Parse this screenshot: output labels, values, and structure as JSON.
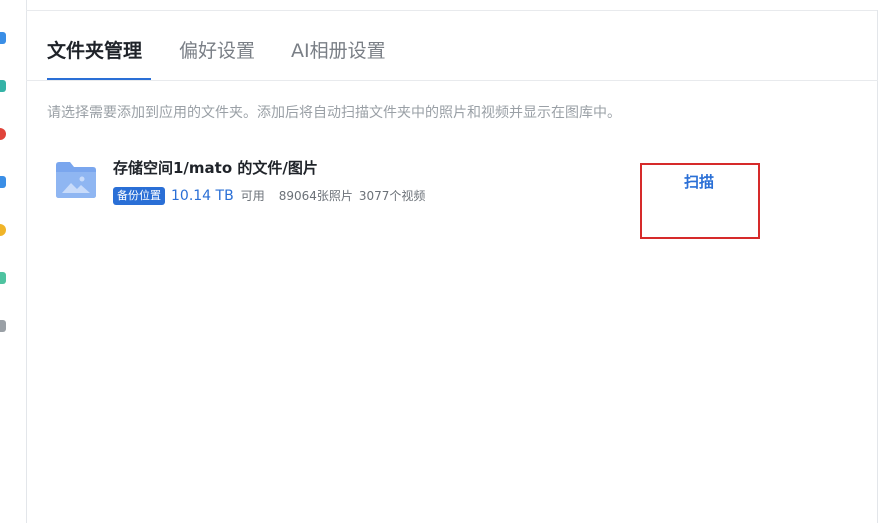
{
  "tabs": [
    {
      "label": "文件夹管理",
      "active": true
    },
    {
      "label": "偏好设置",
      "active": false
    },
    {
      "label": "AI相册设置",
      "active": false
    }
  ],
  "description": "请选择需要添加到应用的文件夹。添加后将自动扫描文件夹中的照片和视频并显示在图库中。",
  "folder": {
    "title": "存储空间1/mato 的文件/图片",
    "badge": "备份位置",
    "size": "10.14 TB",
    "available": "可用",
    "photos": "89064张照片",
    "videos": "3077个视频",
    "action": "扫描"
  },
  "colors": {
    "accent": "#2a6fd6",
    "highlight_box": "#d62a2a"
  },
  "icons": [
    "folder-image-icon"
  ]
}
